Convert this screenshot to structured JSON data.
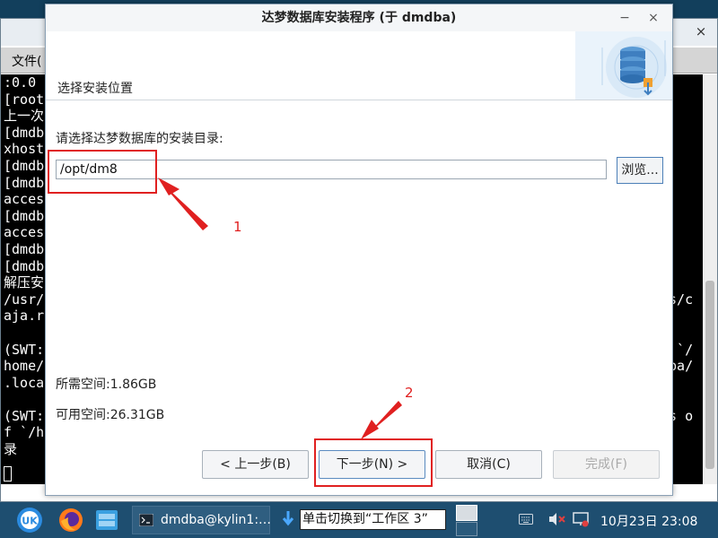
{
  "terminal": {
    "menu_file": "文件(",
    "close_glyph": "×",
    "left_lines": [
      ":0.0",
      "[root",
      "上一次",
      "[dmdb",
      "xhost",
      "[dmdb",
      "[dmdb",
      "acces",
      "[dmdb",
      "acces",
      "[dmdb",
      "[dmdb",
      "解压安",
      "/usr/",
      "aja.r",
      "",
      "(SWT:",
      "home/",
      ".loca",
      "",
      "(SWT:",
      "f `/h",
      "录"
    ],
    "right_lines": [
      "",
      "",
      "",
      "",
      "",
      "",
      "",
      "",
      "",
      "",
      "",
      "",
      "",
      "os/c",
      "",
      "",
      "o `/",
      "dba/",
      "",
      "",
      "as o",
      "目",
      ""
    ]
  },
  "dialog": {
    "title": "达梦数据库安装程序 (于 dmdba)",
    "minimize_glyph": "−",
    "close_glyph": "×",
    "header_title": "选择安装位置",
    "prompt": "请选择达梦数据库的安装目录:",
    "install_path": "/opt/dm8",
    "browse_label": "浏览...",
    "space_required": "所需空间:1.86GB",
    "space_available": "可用空间:26.31GB",
    "buttons": {
      "prev": "< 上一步(B)",
      "next": "下一步(N) >",
      "cancel": "取消(C)",
      "finish": "完成(F)"
    }
  },
  "annotations": {
    "label_1": "1",
    "label_2": "2",
    "color": "#e02020"
  },
  "taskbar": {
    "terminal_task_label": "dmdba@kylin1:…",
    "tooltip": "单击切换到“工作区 3”",
    "clock": "10月23日 23:08",
    "background_color": "#1e4e70"
  },
  "icons": [
    "start-menu-icon",
    "firefox-icon",
    "file-manager-icon",
    "terminal-icon",
    "download-icon",
    "keyboard-icon",
    "volume-muted-icon",
    "network-icon",
    "database-icon"
  ]
}
